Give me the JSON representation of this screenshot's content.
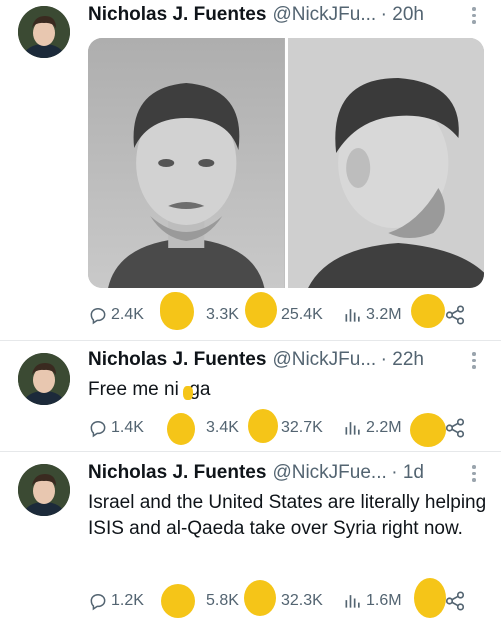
{
  "tweets": [
    {
      "name": "Nicholas J. Fuentes",
      "handle": "@NickJFu...",
      "time": "· 20h",
      "text": "",
      "replies": "2.4K",
      "reposts": "3.3K",
      "likes": "25.4K",
      "views": "3.2M"
    },
    {
      "name": "Nicholas J. Fuentes",
      "handle": "@NickJFu...",
      "time": "· 22h",
      "text": "Free me ni  ga",
      "replies": "1.4K",
      "reposts": "3.4K",
      "likes": "32.7K",
      "views": "2.2M"
    },
    {
      "name": "Nicholas J. Fuentes",
      "handle": "@NickJFue...",
      "time": "· 1d",
      "text": "Israel and the United States are literally helping ISIS and al-Qaeda take over Syria right now.",
      "replies": "1.2K",
      "reposts": "5.8K",
      "likes": "32.3K",
      "views": "1.6M"
    }
  ],
  "icons": {
    "reply": "reply-icon",
    "repost": "repost-icon",
    "like": "like-icon",
    "views": "views-icon",
    "bookmark": "bookmark-icon",
    "share": "share-icon",
    "more": "more-icon"
  },
  "colors": {
    "text": "#0f1419",
    "secondary": "#536471",
    "redaction": "#f5c518"
  }
}
